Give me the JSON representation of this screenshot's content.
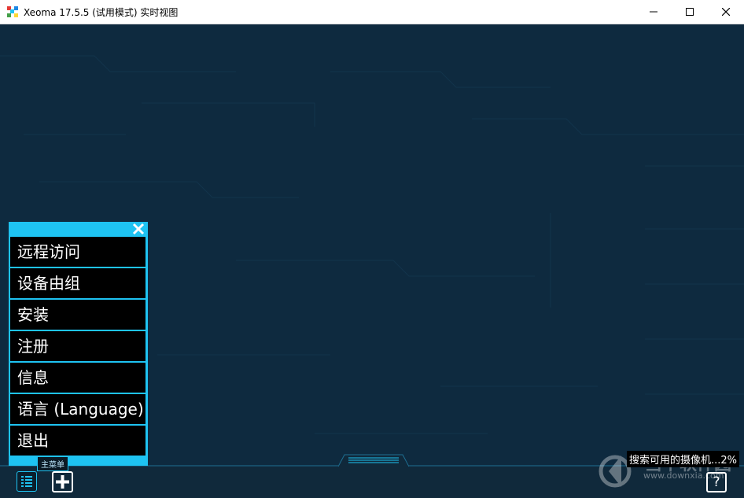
{
  "window": {
    "title": "Xeoma 17.5.5 (试用模式) 实时视图",
    "minimize_icon": "minimize-icon",
    "maximize_icon": "maximize-icon",
    "close_icon": "close-icon"
  },
  "main_menu": {
    "close_icon": "close-icon",
    "items": [
      {
        "label": "远程访问"
      },
      {
        "label": "设备由组"
      },
      {
        "label": "安装"
      },
      {
        "label": "注册"
      },
      {
        "label": "信息"
      },
      {
        "label": "语言 (Language)"
      },
      {
        "label": "退出"
      }
    ],
    "tooltip": "主菜单"
  },
  "bottom_bar": {
    "menu_button_icon": "list-icon",
    "add_button_icon": "plus-icon",
    "help_button_icon": "help-icon",
    "help_label": "?",
    "status_text": "搜索可用的摄像机...2%"
  },
  "watermark": {
    "text": "当下软件园",
    "url": "www.downxia.com"
  },
  "colors": {
    "background": "#0e2a3f",
    "accent": "#1ec3f2",
    "menu_item_bg": "#000000"
  }
}
